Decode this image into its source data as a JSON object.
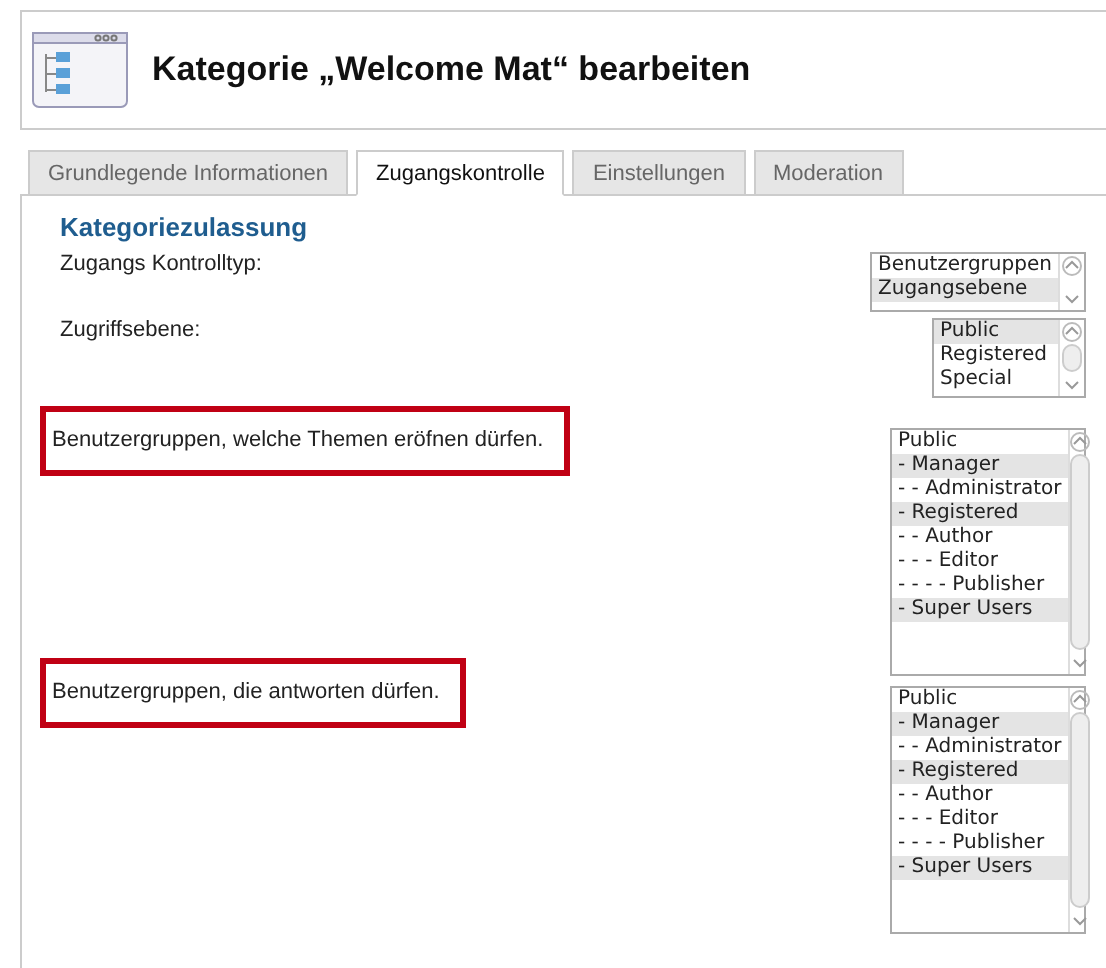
{
  "header": {
    "title": "Kategorie „Welcome Mat“ bearbeiten"
  },
  "tabs": [
    {
      "label": "Grundlegende Informationen",
      "selected": false
    },
    {
      "label": "Zugangskontrolle",
      "selected": true
    },
    {
      "label": "Einstellungen",
      "selected": false
    },
    {
      "label": "Moderation",
      "selected": false
    }
  ],
  "section": {
    "heading": "Kategoriezulassung"
  },
  "fields": [
    {
      "label": "Zugangs Kontrolltyp:",
      "highlighted": false,
      "options": [
        {
          "label": "Benutzergruppen",
          "selected": false
        },
        {
          "label": "Zugangsebene",
          "selected": true
        }
      ]
    },
    {
      "label": "Zugriffsebene:",
      "highlighted": false,
      "options": [
        {
          "label": "Public",
          "selected": true
        },
        {
          "label": "Registered",
          "selected": false
        },
        {
          "label": "Special",
          "selected": false
        }
      ]
    },
    {
      "label": "Benutzergruppen, welche Themen eröfnen dürfen.",
      "highlighted": true,
      "options": [
        {
          "label": "Public",
          "selected": false
        },
        {
          "label": "- Manager",
          "selected": true
        },
        {
          "label": "- - Administrator",
          "selected": false
        },
        {
          "label": "- Registered",
          "selected": true
        },
        {
          "label": "- - Author",
          "selected": false
        },
        {
          "label": "- - - Editor",
          "selected": false
        },
        {
          "label": "- - - - Publisher",
          "selected": false
        },
        {
          "label": "- Super Users",
          "selected": true
        }
      ]
    },
    {
      "label": "Benutzergruppen, die antworten dürfen.",
      "highlighted": true,
      "options": [
        {
          "label": "Public",
          "selected": false
        },
        {
          "label": "- Manager",
          "selected": true
        },
        {
          "label": "- - Administrator",
          "selected": false
        },
        {
          "label": "- Registered",
          "selected": true
        },
        {
          "label": "- - Author",
          "selected": false
        },
        {
          "label": "- - - Editor",
          "selected": false
        },
        {
          "label": "- - - - Publisher",
          "selected": false
        },
        {
          "label": "- Super Users",
          "selected": true
        }
      ]
    }
  ]
}
